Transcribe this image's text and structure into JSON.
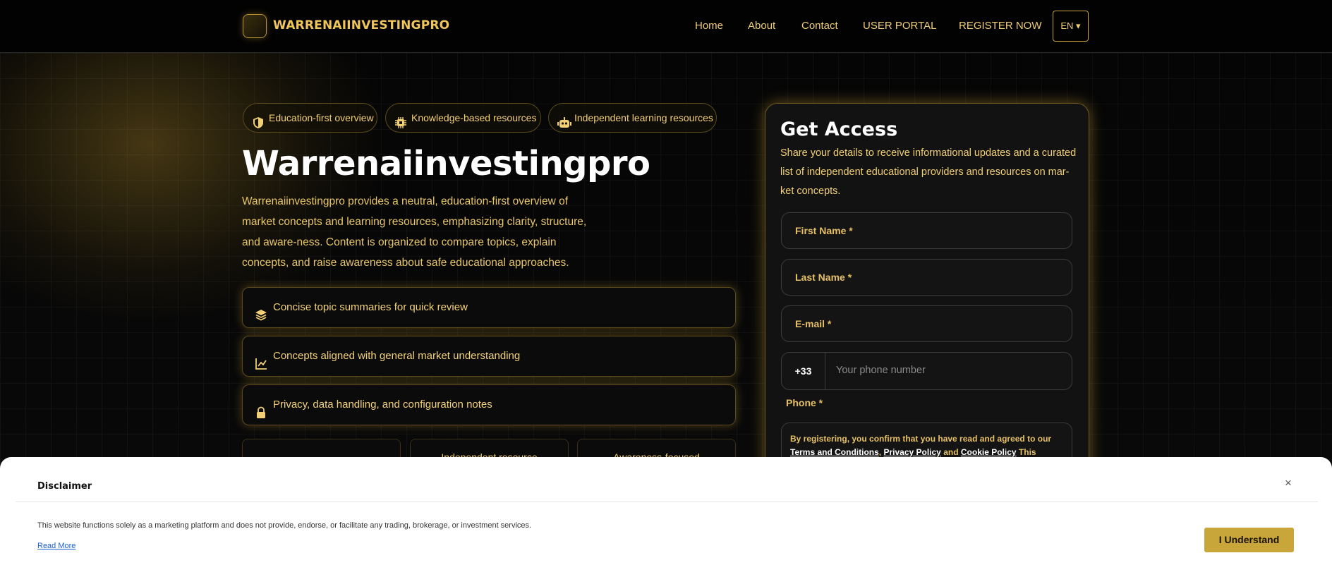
{
  "header": {
    "logo_text": "WARRENAIINVESTINGPRO",
    "nav": [
      {
        "label": "Home"
      },
      {
        "label": "About"
      },
      {
        "label": "Contact"
      },
      {
        "label": "USER PORTAL"
      },
      {
        "label": "REGISTER NOW"
      }
    ],
    "lang": "EN ▾"
  },
  "hero": {
    "badges": [
      {
        "icon": "shield-icon",
        "label": "Education-first overview"
      },
      {
        "icon": "chip-icon",
        "label": "Knowledge-based resources"
      },
      {
        "icon": "robot-icon",
        "label": "Independent learning resources"
      }
    ],
    "title": "Warrenaiinvestingpro",
    "description": "Warrenaiinvestingpro provides a neutral, education-first overview of market concepts and learning resources, emphasizing clarity, structure, and aware-ness. Content is organized to compare topics, explain concepts, and raise awareness about safe educational approaches.",
    "features": [
      {
        "icon": "layers-icon",
        "label": "Concise topic summaries for quick review"
      },
      {
        "icon": "chart-line-icon",
        "label": "Concepts aligned with general market understanding"
      },
      {
        "icon": "lock-icon",
        "label": "Privacy, data handling, and configuration notes"
      }
    ],
    "stats": [
      {
        "label": ""
      },
      {
        "label": "Independent resource"
      },
      {
        "label": "Awareness-focused"
      }
    ]
  },
  "form": {
    "title": "Get Access",
    "description": "Share your details to receive informational updates and a curated list of independent educational providers and resources on mar-ket concepts.",
    "first_name": "First Name *",
    "last_name": "Last Name *",
    "email": "E-mail *",
    "phone_code": "+33",
    "phone_placeholder": "Your phone number",
    "phone_label": "Phone *",
    "terms_prefix": "By registering, you confirm that you have read and agreed to our ",
    "terms_link": "Terms and Conditions",
    "sep1": ", ",
    "privacy_link": "Privacy Policy",
    "sep2": " and ",
    "cookie_link": "Cookie Policy",
    "terms_suffix": " This website operates"
  },
  "disclaimer": {
    "title": "Disclaimer",
    "close": "×",
    "text": "This website functions solely as a marketing platform and does not provide, endorse, or facilitate any trading, brokerage, or investment services.",
    "read_more": "Read More",
    "button": "I Understand"
  }
}
